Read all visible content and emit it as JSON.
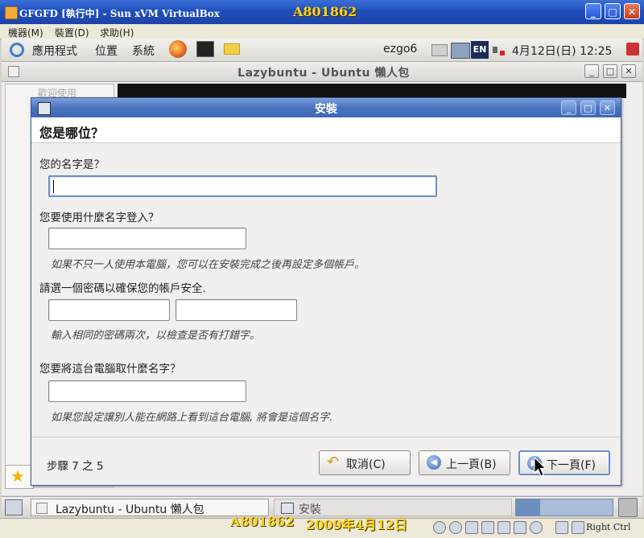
{
  "vbox": {
    "title": "GFGFD [執行中] - Sun xVM VirtualBox",
    "menu": [
      "機器(M)",
      "裝置(D)",
      "求助(H)"
    ],
    "status_host_key": "Right Ctrl"
  },
  "watermark": {
    "top": "A801862",
    "bottom_id": "A801862",
    "bottom_date": "2009年4月12日"
  },
  "gnome_panel": {
    "menus": [
      "應用程式",
      "位置",
      "系統"
    ],
    "username": "ezgo6",
    "ime": "EN",
    "clock": "4月12日(日) 12:25"
  },
  "app_window": {
    "title": "Lazybuntu - Ubuntu 懶人包",
    "sidebar_partial": "歡迎使用"
  },
  "dialog": {
    "title": "安裝",
    "heading": "您是哪位？",
    "name_label": "您的名字是？",
    "name_value": "",
    "login_label": "您要使用什麼名字登入？",
    "login_value": "",
    "login_hint": "如果不只一人使用本電腦，您可以在安裝完成之後再設定多個帳戶。",
    "password_label": "請選一個密碼以確保您的帳戶安全.",
    "password_hint": "輸入相同的密碼兩次，以檢查是否有打錯字。",
    "hostname_label": "您要將這台電腦取什麼名字？",
    "hostname_value": "",
    "hostname_hint": "如果您設定讓別人能在網路上看到這台電腦, 將會是這個名字.",
    "step": "步驟 7 之 5",
    "cancel_label": "取消(C)",
    "back_label": "上一頁(B)",
    "next_label": "下一頁(F)"
  },
  "taskbar": {
    "item1": "Lazybuntu - Ubuntu 懶人包",
    "item2": "安裝"
  }
}
